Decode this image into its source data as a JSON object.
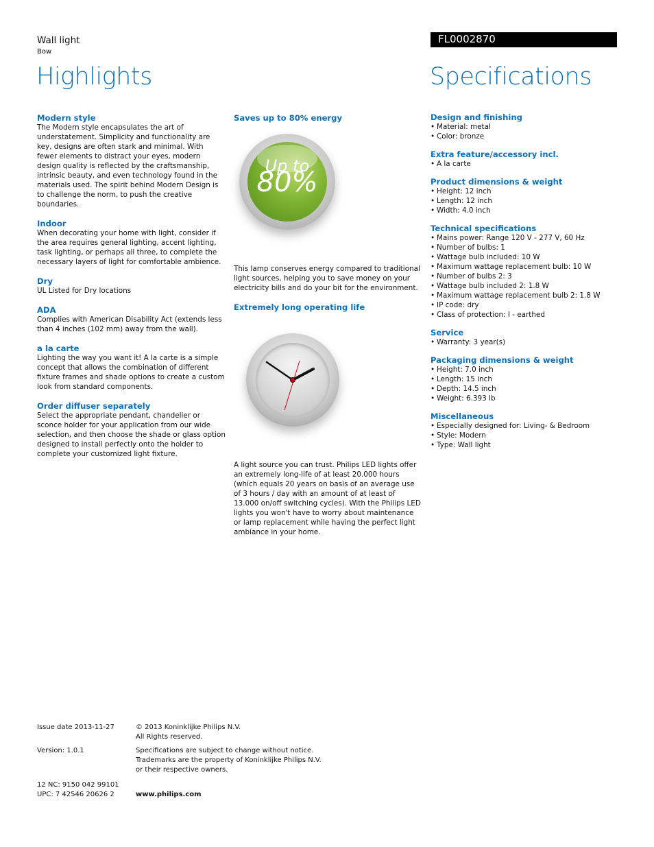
{
  "header": {
    "product_type": "Wall light",
    "product_name": "Bow",
    "product_code": "FL0002870",
    "highlights_title": "Highlights",
    "specifications_title": "Specifications"
  },
  "highlights": [
    {
      "title": "Modern style",
      "text": "The Modern style encapsulates the art of understatement. Simplicity and functionality are key, designs are often stark and minimal. With fewer elements to distract your eyes, modern design quality is reflected by the craftsmanship, intrinsic beauty, and even technology found in the materials used. The spirit behind Modern Design is to challenge the norm, to push the creative boundaries."
    },
    {
      "title": "Indoor",
      "text": "When decorating your home with light, consider if the area requires general lighting, accent lighting, task lighting, or perhaps all three, to complete the necessary layers of light for comfortable ambience."
    },
    {
      "title": "Dry",
      "text": "UL Listed for Dry locations"
    },
    {
      "title": "ADA",
      "text": "Complies with American Disability Act (extends less than 4 inches (102 mm) away from the wall)."
    },
    {
      "title": "a la carte",
      "text": "Lighting the way you want it! A la carte is a simple concept that allows the combination of different fixture frames and shade options to create a custom look from standard components."
    },
    {
      "title": "Order diffuser separately",
      "text": "Select the appropriate pendant, chandelier or sconce holder for your application from our wide selection, and then choose the shade or glass option designed to install perfectly onto the holder to complete your customized light fixture."
    }
  ],
  "features": [
    {
      "title": "Saves up to 80% energy",
      "badge_line1": "Up to",
      "badge_line2": "80%",
      "icon": "energy-badge-icon",
      "text": "This lamp conserves energy compared to traditional light sources, helping you to save money on your electricity bills and do your bit for the environment."
    },
    {
      "title": "Extremely long operating life",
      "icon": "clock-icon",
      "text": "A light source you can trust. Philips LED lights offer an extremely long-life of at least 20.000 hours (which equals 20 years on basis of an average use of 3 hours / day with an amount of at least of 13.000 on/off switching cycles). With the Philips LED lights you won't have to worry about maintenance or lamp replacement while having the perfect light ambiance in your home."
    }
  ],
  "specifications": [
    {
      "title": "Design and finishing",
      "items": [
        "Material: metal",
        "Color: bronze"
      ]
    },
    {
      "title": "Extra feature/accessory incl.",
      "items": [
        "A la carte"
      ]
    },
    {
      "title": "Product dimensions & weight",
      "items": [
        "Height: 12 inch",
        "Length: 12 inch",
        "Width: 4.0 inch"
      ]
    },
    {
      "title": "Technical specifications",
      "items": [
        "Mains power: Range 120 V - 277 V, 60 Hz",
        "Number of bulbs: 1",
        "Wattage bulb included: 10 W",
        "Maximum wattage replacement bulb: 10 W",
        "Number of bulbs 2: 3",
        "Wattage bulb included 2: 1.8 W",
        "Maximum wattage replacement bulb 2: 1.8 W",
        "IP code: dry",
        "Class of protection: I - earthed"
      ]
    },
    {
      "title": "Service",
      "items": [
        "Warranty: 3 year(s)"
      ]
    },
    {
      "title": "Packaging dimensions & weight",
      "items": [
        "Height: 7.0 inch",
        "Length: 15 inch",
        "Depth: 14.5 inch",
        "Weight: 6.393 lb"
      ]
    },
    {
      "title": "Miscellaneous",
      "items": [
        "Especially designed for: Living- & Bedroom",
        "Style: Modern",
        "Type: Wall light"
      ]
    }
  ],
  "footer": {
    "issue_date": "Issue date 2013-11-27",
    "version": "Version: 1.0.1",
    "nc": "12 NC: 9150 042 99101",
    "upc": "UPC: 7 42546 20626 2",
    "copyright_1": "© 2013 Koninklijke Philips N.V.",
    "copyright_2": "All Rights reserved.",
    "disclaimer_1": "Specifications are subject to change without notice.",
    "disclaimer_2": "Trademarks are the property of Koninklijke Philips N.V.",
    "disclaimer_3": "or their respective owners.",
    "website": "www.philips.com"
  },
  "colors": {
    "accent": "#0e6fb4",
    "code_bar": "#000000",
    "badge_green": "#7fb332",
    "clock_second_hand": "#d0021b"
  }
}
